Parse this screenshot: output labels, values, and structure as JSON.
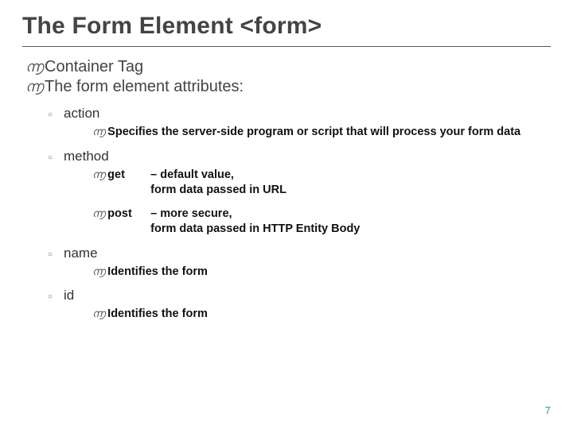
{
  "glyphs": {
    "swirl": "൬",
    "circle": "○"
  },
  "title": "The Form Element <form>",
  "top": [
    "Container Tag",
    "The form element attributes:"
  ],
  "attrs": [
    {
      "name": "action",
      "entries": [
        {
          "kind": "line",
          "text": "Specifies the server-side program or script that will process your form data"
        }
      ]
    },
    {
      "name": "method",
      "entries": [
        {
          "kind": "kv",
          "key": "get ",
          "val": "– default value,\nform data passed in URL"
        },
        {
          "kind": "kv",
          "key": "post ",
          "val": "– more secure,\nform data passed in HTTP Entity Body"
        }
      ]
    },
    {
      "name": "name",
      "entries": [
        {
          "kind": "line",
          "text": "Identifies the form"
        }
      ]
    },
    {
      "name": "id",
      "entries": [
        {
          "kind": "line",
          "text": "Identifies the form"
        }
      ]
    }
  ],
  "page": "7"
}
